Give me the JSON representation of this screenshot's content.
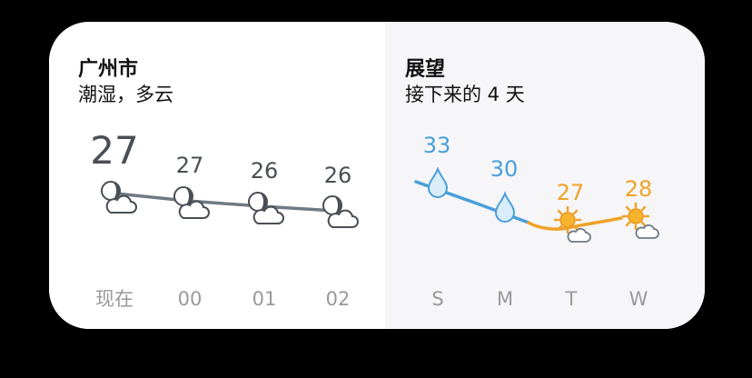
{
  "hourly": {
    "city": "广州市",
    "condition": "潮湿，多云",
    "items": [
      {
        "label": "现在",
        "temp": "27",
        "icon": "night-partly-cloudy-icon"
      },
      {
        "label": "00",
        "temp": "27",
        "icon": "night-partly-cloudy-icon"
      },
      {
        "label": "01",
        "temp": "26",
        "icon": "night-partly-cloudy-icon"
      },
      {
        "label": "02",
        "temp": "26",
        "icon": "night-partly-cloudy-icon"
      }
    ]
  },
  "forecast": {
    "title": "展望",
    "subtitle": "接下来的 4 天",
    "items": [
      {
        "label": "S",
        "temp": "33",
        "icon": "rain-drop-icon"
      },
      {
        "label": "M",
        "temp": "30",
        "icon": "rain-drop-icon"
      },
      {
        "label": "T",
        "temp": "27",
        "icon": "sun-cloud-icon"
      },
      {
        "label": "W",
        "temp": "28",
        "icon": "sun-cloud-icon"
      }
    ]
  },
  "colors": {
    "rain": "#4a9fd8",
    "sun": "#f0a22a",
    "line_gray": "#6e7a84",
    "label_gray": "#9a9a9e"
  }
}
